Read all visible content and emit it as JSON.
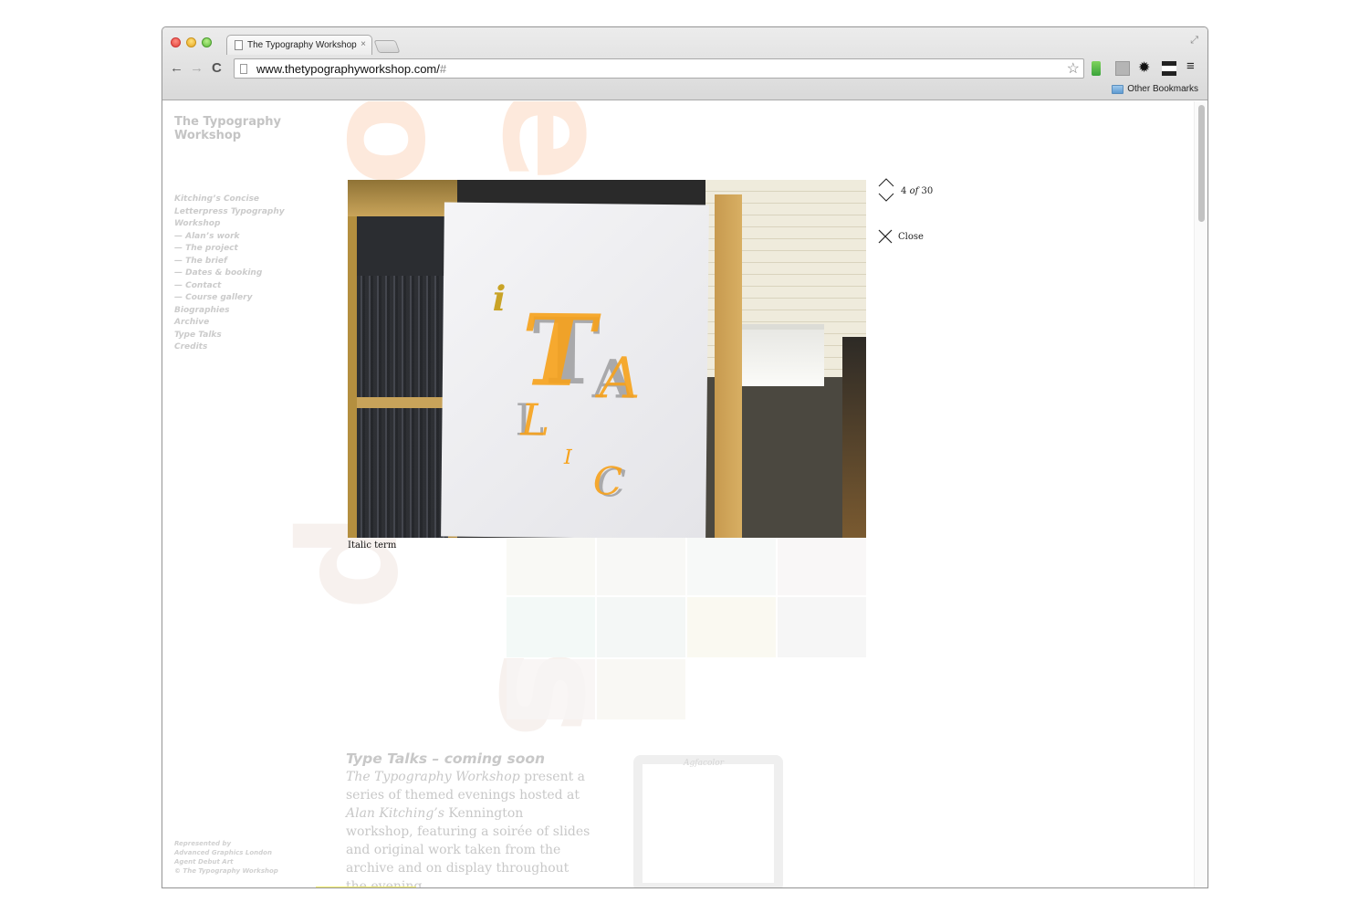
{
  "browser": {
    "tab_title": "The Typography Workshop",
    "tab_close_glyph": "×",
    "url_main": "www.thetypographyworkshop.com/",
    "url_hash": "#",
    "back_glyph": "←",
    "forward_glyph": "→",
    "reload_glyph": "C",
    "star_glyph": "☆",
    "settings_glyph": "✹",
    "menu_glyph": "≡",
    "fullscreen_glyph": "⤢",
    "bookmarks_label": "Other Bookmarks",
    "extensions": [
      "green-extension-icon",
      "grey-extension-icon",
      "settings-extension-icon",
      "reader-extension-icon",
      "menu-icon"
    ]
  },
  "site": {
    "logo_line1": "The Typography",
    "logo_line2": "Workshop",
    "nav": [
      {
        "label": "Kitching’s Concise"
      },
      {
        "label": "Letterpress Typography"
      },
      {
        "label": "Workshop"
      },
      {
        "label": "— Alan’s work"
      },
      {
        "label": "— The project"
      },
      {
        "label": "— The brief"
      },
      {
        "label": "— Dates & booking"
      },
      {
        "label": "— Contact"
      },
      {
        "label": "— Course gallery"
      },
      {
        "label": "Biographies"
      },
      {
        "label": "Archive"
      },
      {
        "label": "Type Talks"
      },
      {
        "label": "Credits"
      }
    ],
    "footer": [
      "Represented by",
      "Advanced Graphics London",
      "Agent Debut Art",
      "© The Typography Workshop"
    ],
    "background_letters": [
      "o",
      "e",
      "p",
      "s"
    ],
    "type_talks": {
      "heading": "Type Talks – coming soon",
      "p_italic1": "The Typography Workshop",
      "p_text1": " present a series of themed evenings hosted at ",
      "p_italic2": "Alan Kitching’s",
      "p_text2": " Kennington workshop, featuring a soirée of slides and original work taken from the archive and on display throughout the evening."
    },
    "slide_brand": "Agfacolor",
    "gallery_thumb_count": 10
  },
  "lightbox": {
    "caption": "Italic term",
    "current": "4",
    "of_label": "of",
    "total": "30",
    "close_label": "Close",
    "print_letters": [
      "i",
      "T",
      "A",
      "L",
      "I",
      "C"
    ],
    "accent_color": "#f7a21b",
    "grey_ink": "#a9a9ab"
  }
}
